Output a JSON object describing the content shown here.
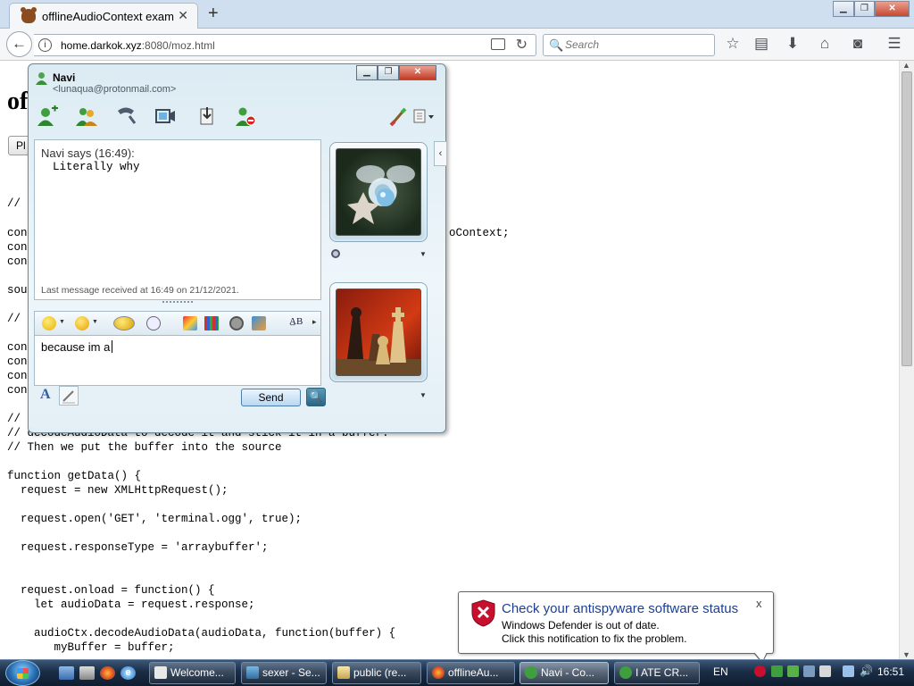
{
  "browser": {
    "tab_title": "offlineAudioContext examp",
    "tab_close": "✕",
    "new_tab": "+",
    "window_controls": {
      "minimize": "▁",
      "maximize": "❐",
      "close": "✕"
    },
    "back": "←",
    "info": "i",
    "url_host": "home.darkok.xyz",
    "url_path": ":8080/moz.html",
    "reload": "↻",
    "search_icon": "🔍",
    "search_placeholder": "Search",
    "toolbar_icons": [
      "star-icon",
      "reading-list-icon",
      "download-icon",
      "home-icon",
      "pocket-icon",
      "menu-icon"
    ]
  },
  "page": {
    "heading_fragment": "of",
    "button_label": "Pl",
    "code_lines": [
      {
        "text": "//"
      },
      {
        "text": "con"
      },
      {
        "text": "con"
      },
      {
        "text": "con"
      },
      {
        "text": "sou"
      },
      {
        "text": "//"
      },
      {
        "text": "con"
      },
      {
        "text": "con"
      },
      {
        "text": "con"
      },
      {
        "text": "con"
      },
      {
        "text": "//"
      },
      {
        "text": "// decodeAudioData to decode it and stick it in a buffer."
      },
      {
        "text": "// Then we put the buffer into the source"
      },
      {
        "text": "function getData() {"
      },
      {
        "text": "  request = new XMLHttpRequest();"
      },
      {
        "text": "  request.open('GET', 'terminal.ogg', true);"
      },
      {
        "text": "  request.responseType = 'arraybuffer';"
      },
      {
        "text": "  request.onload = function() {"
      },
      {
        "text": "    let audioData = request.response;"
      },
      {
        "text": "    audioCtx.decodeAudioData(audioData, function(buffer) {"
      },
      {
        "text": "       myBuffer = buffer;"
      }
    ],
    "code_fragment_right": "oContext;"
  },
  "messenger": {
    "contact_name": "Navi",
    "contact_email": "<lunaqua@protonmail.com>",
    "window_controls": {
      "minimize": "▁",
      "maximize": "❐",
      "close": "✕"
    },
    "toolbar_icons": [
      "invite-contact-icon",
      "share-contacts-icon",
      "call-icon",
      "video-call-icon",
      "send-files-icon",
      "block-contact-icon",
      "paint-brush-icon",
      "layout-options-icon"
    ],
    "conversation": {
      "sender_line": "Navi says (16:49):",
      "message": "Literally why",
      "status": "Last message received at 16:49 on 21/12/2021."
    },
    "compose_text": "because im a",
    "send_label": "Send",
    "font_button": "A",
    "side_arrow": "‹"
  },
  "notification": {
    "title": "Check your antispyware software status",
    "line1": "Windows Defender is out of date.",
    "line2": "Click this notification to fix the problem.",
    "close": "x"
  },
  "taskbar": {
    "tasks": [
      {
        "label": "Welcome..."
      },
      {
        "label": "sexer - Se..."
      },
      {
        "label": "public (re..."
      },
      {
        "label": "offlineAu..."
      },
      {
        "label": "Navi - Co..."
      },
      {
        "label": "I ATE CR..."
      }
    ],
    "language": "EN",
    "time": "16:51"
  }
}
